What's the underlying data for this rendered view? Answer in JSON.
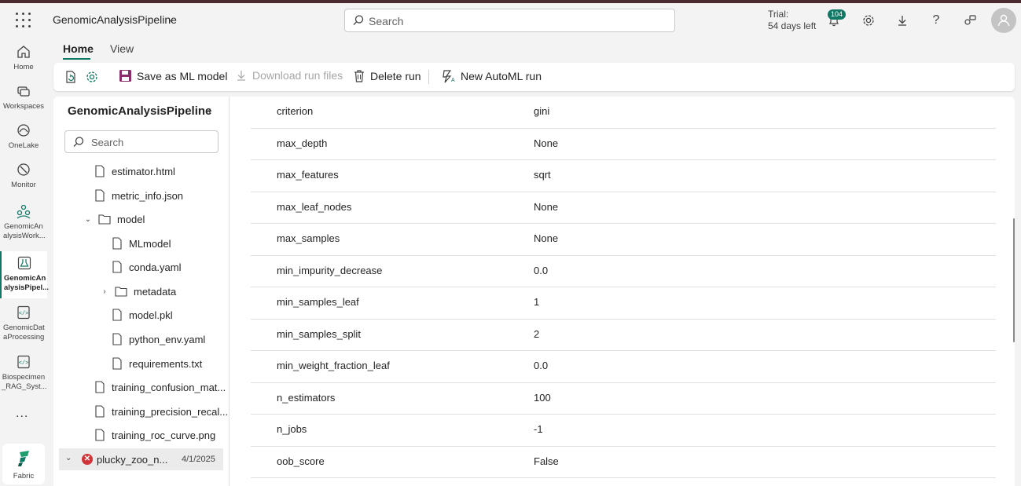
{
  "app": {
    "workspace_title": "GenomicAnalysisPipeline",
    "search_placeholder": "Search",
    "trial_line1": "Trial:",
    "trial_line2": "54 days left",
    "notification_count": "104"
  },
  "leftnav": {
    "items": [
      {
        "label": "Home",
        "icon": "home-icon"
      },
      {
        "label": "Workspaces",
        "icon": "workspaces-icon"
      },
      {
        "label": "OneLake",
        "icon": "onelake-icon"
      },
      {
        "label": "Monitor",
        "icon": "monitor-icon"
      },
      {
        "label": "GenomicAn alysisWork...",
        "icon": "workspace-people-icon"
      },
      {
        "label": "GenomicAn alysisPipel...",
        "icon": "experiment-icon"
      },
      {
        "label": "GenomicDat aProcessing",
        "icon": "notebook-icon"
      },
      {
        "label": "Biospecimen _RAG_Syst...",
        "icon": "notebook-icon"
      }
    ],
    "more": "...",
    "fabric_label": "Fabric"
  },
  "tabs": [
    {
      "label": "Home",
      "active": true
    },
    {
      "label": "View",
      "active": false
    }
  ],
  "toolbar": {
    "save_ml": "Save as ML model",
    "download": "Download run files",
    "delete": "Delete run",
    "new_automl": "New AutoML run"
  },
  "tree": {
    "title": "GenomicAnalysisPipeline",
    "search_placeholder": "Search",
    "items": [
      {
        "label": "estimator.html",
        "type": "file"
      },
      {
        "label": "metric_info.json",
        "type": "file"
      },
      {
        "label": "model",
        "type": "folder-open"
      },
      {
        "label": "MLmodel",
        "type": "file"
      },
      {
        "label": "conda.yaml",
        "type": "file"
      },
      {
        "label": "metadata",
        "type": "folder-closed"
      },
      {
        "label": "model.pkl",
        "type": "file"
      },
      {
        "label": "python_env.yaml",
        "type": "file"
      },
      {
        "label": "requirements.txt",
        "type": "file"
      },
      {
        "label": "training_confusion_mat...",
        "type": "file"
      },
      {
        "label": "training_precision_recal...",
        "type": "file"
      },
      {
        "label": "training_roc_curve.png",
        "type": "file"
      }
    ],
    "run": {
      "name": "plucky_zoo_n...",
      "date": "4/1/2025",
      "status": "error"
    }
  },
  "params": [
    {
      "key": "criterion",
      "value": "gini"
    },
    {
      "key": "max_depth",
      "value": "None"
    },
    {
      "key": "max_features",
      "value": "sqrt"
    },
    {
      "key": "max_leaf_nodes",
      "value": "None"
    },
    {
      "key": "max_samples",
      "value": "None"
    },
    {
      "key": "min_impurity_decrease",
      "value": "0.0"
    },
    {
      "key": "min_samples_leaf",
      "value": "1"
    },
    {
      "key": "min_samples_split",
      "value": "2"
    },
    {
      "key": "min_weight_fraction_leaf",
      "value": "0.0"
    },
    {
      "key": "n_estimators",
      "value": "100"
    },
    {
      "key": "n_jobs",
      "value": "-1"
    },
    {
      "key": "oob_score",
      "value": "False"
    }
  ]
}
